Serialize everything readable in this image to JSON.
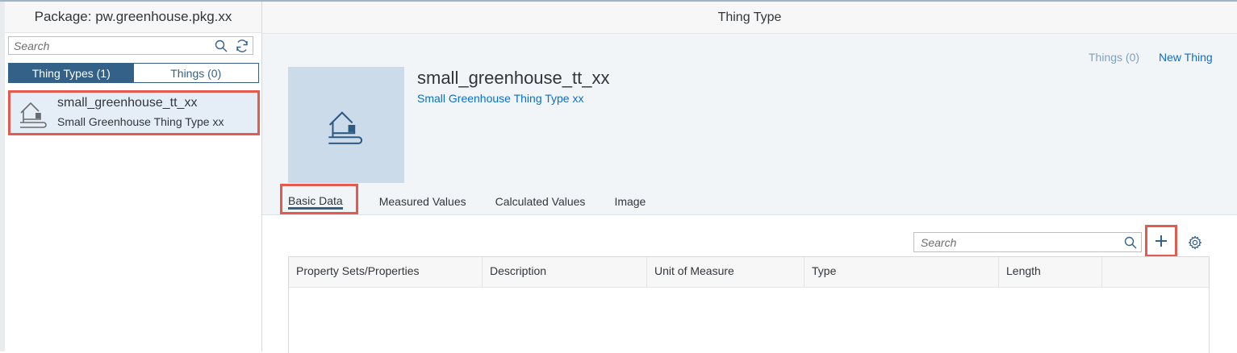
{
  "master": {
    "title": "Package: pw.greenhouse.pkg.xx",
    "search_placeholder": "Search",
    "segments": [
      {
        "label": "Thing Types (1)",
        "active": true
      },
      {
        "label": "Things (0)",
        "active": false
      }
    ],
    "items": [
      {
        "title": "small_greenhouse_tt_xx",
        "description": "Small Greenhouse Thing Type xx",
        "icon": "greenhouse-icon"
      }
    ]
  },
  "detail": {
    "header_title": "Thing Type",
    "links": {
      "things": "Things (0)",
      "new_thing": "New Thing"
    },
    "object": {
      "title": "small_greenhouse_tt_xx",
      "subtitle": "Small Greenhouse Thing Type xx",
      "image_icon": "greenhouse-icon"
    },
    "tabs": [
      {
        "label": "Basic Data",
        "active": true
      },
      {
        "label": "Measured Values",
        "active": false
      },
      {
        "label": "Calculated Values",
        "active": false
      },
      {
        "label": "Image",
        "active": false
      }
    ],
    "table": {
      "search_placeholder": "Search",
      "columns": [
        "Property Sets/Properties",
        "Description",
        "Unit of Measure",
        "Type",
        "Length",
        ""
      ],
      "rows": []
    }
  },
  "colors": {
    "accent": "#346187",
    "link": "#0a6ed1",
    "highlight": "#e45a4f",
    "header_bg": "#f2f5f8",
    "image_bg": "#ccdbea"
  }
}
